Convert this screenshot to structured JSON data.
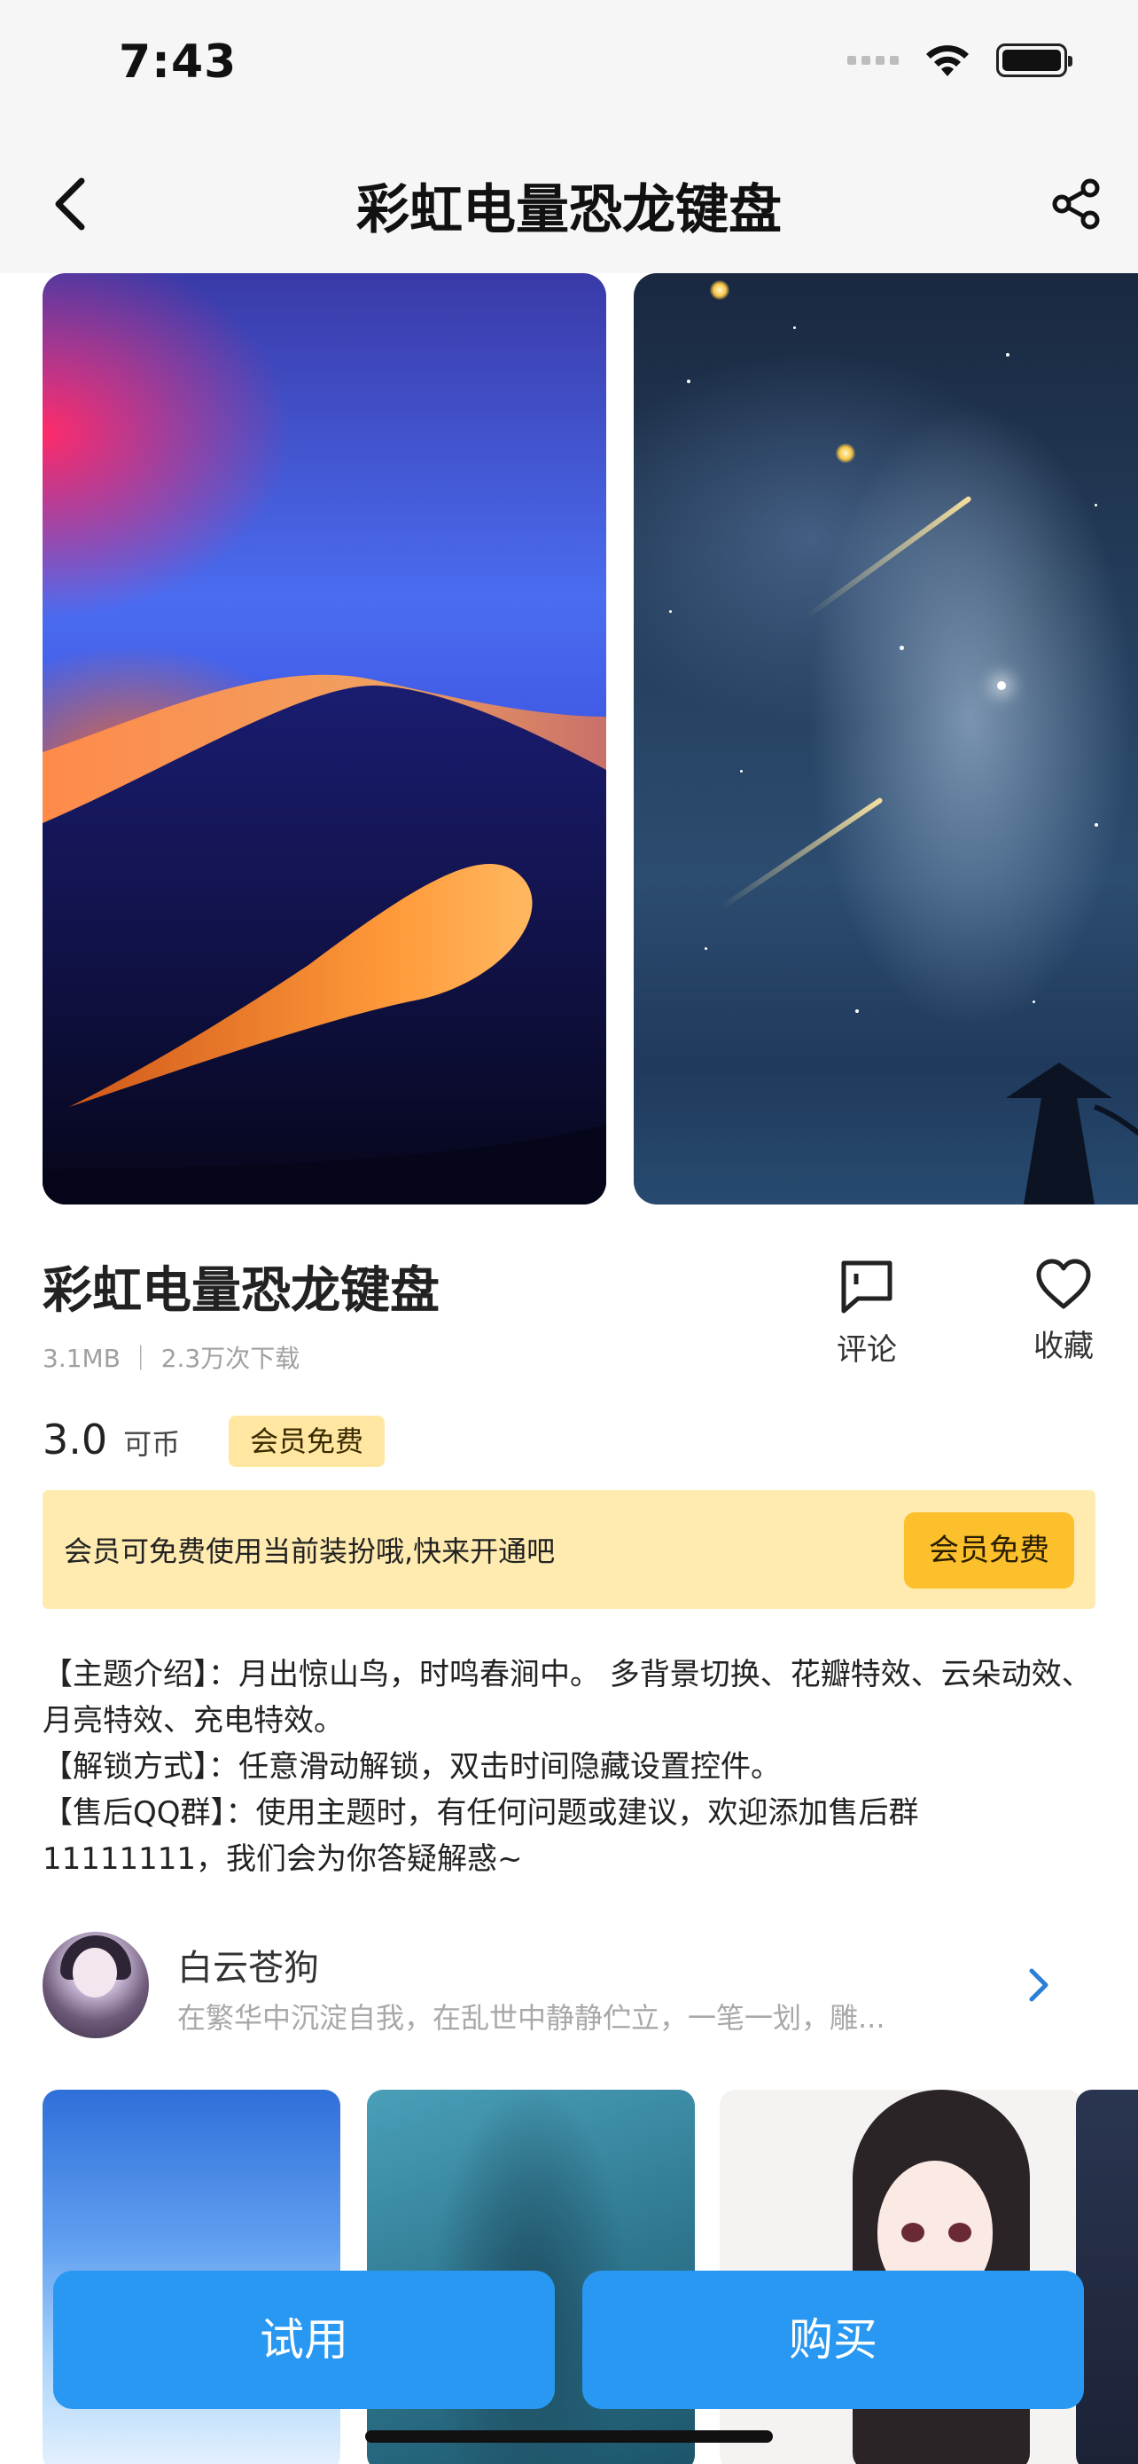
{
  "status_bar": {
    "time": "7:43",
    "icons": [
      "signal-icon",
      "wifi-icon",
      "battery-icon"
    ]
  },
  "nav": {
    "title": "彩虹电量恐龙键盘",
    "back_icon": "chevron-left-icon",
    "share_icon": "share-icon"
  },
  "theme": {
    "name": "彩虹电量恐龙键盘",
    "meta": "3.1MB ｜ 2.3万次下载",
    "price": "3.0",
    "price_unit": "可币",
    "vip_tag": "会员免费"
  },
  "actions": {
    "comment_label": "评论",
    "favorite_label": "收藏"
  },
  "vip_banner": {
    "text": "会员可免费使用当前装扮哦,快来开通吧",
    "button": "会员免费"
  },
  "description": [
    "【主题介绍】：月出惊山鸟，时鸣春涧中。 多背景切换、花瓣特效、云朵动效、月亮特效、充电特效。",
    "【解锁方式】：任意滑动解锁，双击时间隐藏设置控件。",
    "【售后QQ群】：使用主题时，有任何问题或建议，欢迎添加售后群11111111，我们会为你答疑解惑~"
  ],
  "author": {
    "name": "白云苍狗",
    "bio": "在繁华中沉淀自我，在乱世中静静伫立，一笔一划，雕..."
  },
  "buttons": {
    "try": "试用",
    "buy": "购买"
  },
  "colors": {
    "primary_button": "#2998f2",
    "vip_banner_bg": "#ffebb0",
    "vip_button": "#fcc02c",
    "vip_tag_bg": "#ffe7a2"
  }
}
